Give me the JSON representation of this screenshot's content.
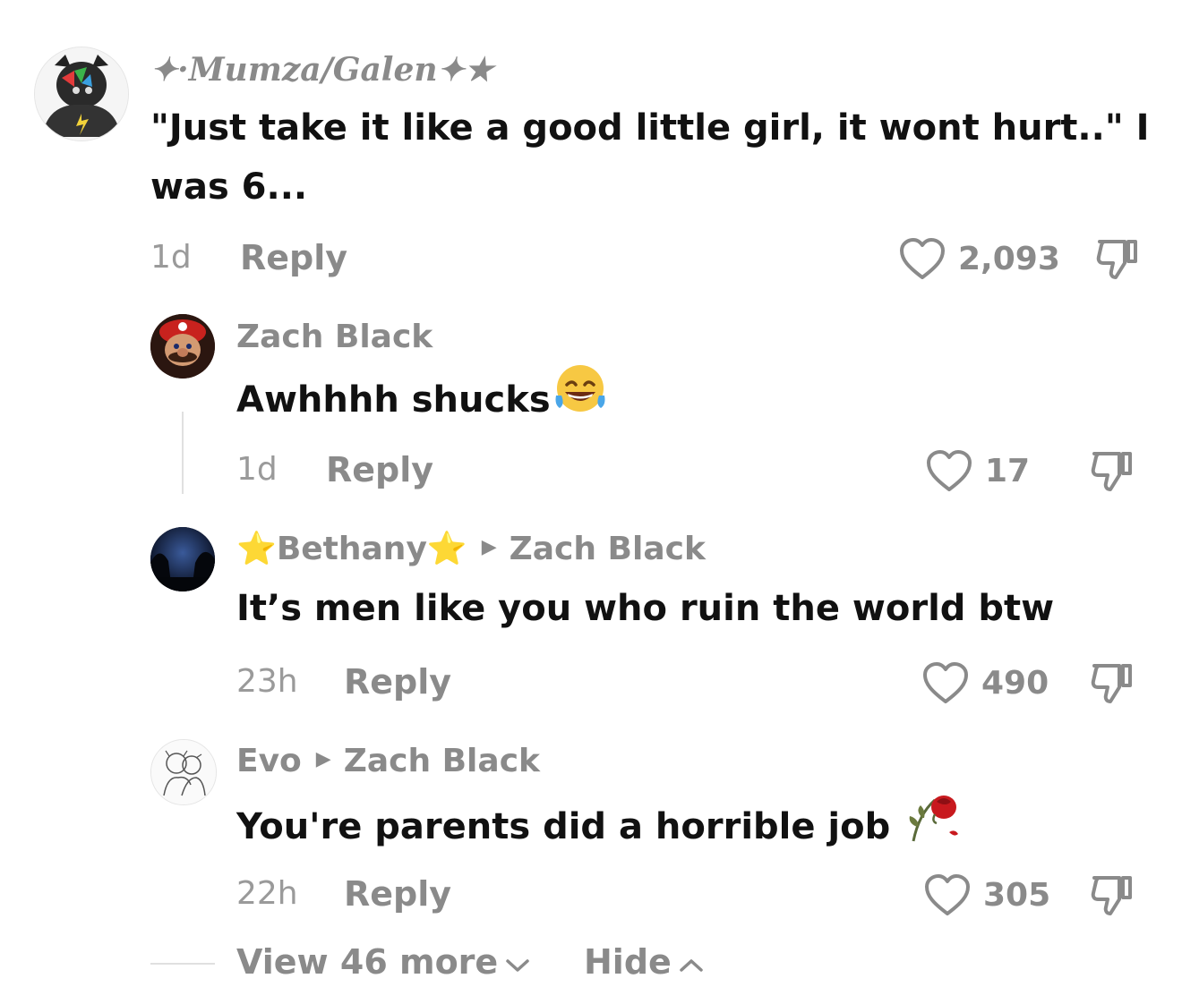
{
  "comments": [
    {
      "username": "✦·Mumza/Galen✦★",
      "text_line1": "\"Just take it like a good little girl, it wont hurt..\" I",
      "text_line2": "was 6...",
      "time": "1d",
      "reply_label": "Reply",
      "likes": "2,093",
      "avatar_icon": "wolf-hoodie-avatar"
    },
    {
      "username": "Zach Black",
      "text": "Awhhhh shucks",
      "emoji": "laughing-tears-emoji",
      "time": "1d",
      "reply_label": "Reply",
      "likes": "17",
      "avatar_icon": "mario-avatar"
    },
    {
      "username": "⭐Bethany⭐",
      "reply_to": "Zach Black",
      "text": "It’s men like you who ruin the world btw",
      "time": "23h",
      "reply_label": "Reply",
      "likes": "490",
      "avatar_icon": "night-sky-avatar"
    },
    {
      "username": "Evo",
      "reply_to": "Zach Black",
      "text": "You're parents did a horrible job",
      "emoji": "wilted-rose-emoji",
      "time": "22h",
      "reply_label": "Reply",
      "likes": "305",
      "avatar_icon": "sketch-avatar"
    }
  ],
  "footer": {
    "view_more": "View 46 more",
    "hide": "Hide"
  },
  "colors": {
    "muted": "#8a8a8a",
    "text": "#111111",
    "divider": "#e0e0e0"
  }
}
